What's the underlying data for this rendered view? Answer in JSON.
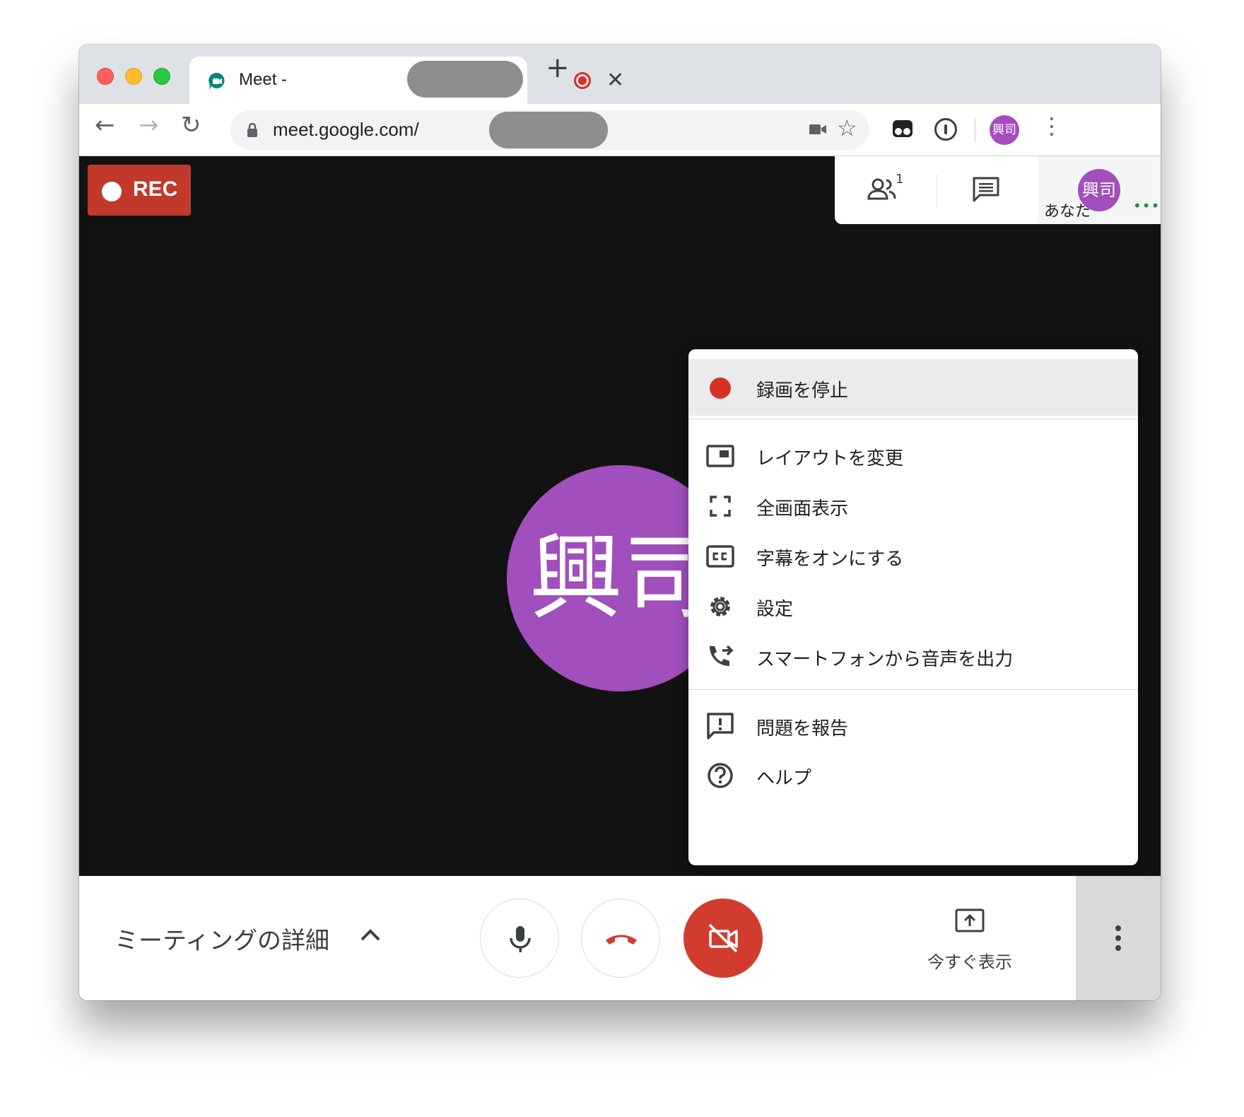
{
  "browser": {
    "tab": {
      "title": "Meet -",
      "close_glyph": "✕"
    },
    "new_tab_glyph": "+",
    "url": "meet.google.com/",
    "profile_initials": "興司",
    "nav": {
      "back": "←",
      "forward": "→",
      "reload": "↻",
      "star": "☆",
      "menu": "⋮"
    }
  },
  "meeting": {
    "rec_label": "REC",
    "participant_initials": "興司",
    "people_count": "1",
    "self_initials": "興司",
    "self_label": "あなた",
    "self_dots": "•••"
  },
  "menu": {
    "items": [
      {
        "label": "録画を停止",
        "icon": "record-dot-icon"
      },
      {
        "label": "レイアウトを変更",
        "icon": "layout-icon"
      },
      {
        "label": "全画面表示",
        "icon": "fullscreen-icon"
      },
      {
        "label": "字幕をオンにする",
        "icon": "closed-caption-icon"
      },
      {
        "label": "設定",
        "icon": "gear-icon"
      },
      {
        "label": "スマートフォンから音声を出力",
        "icon": "phone-forward-icon"
      },
      {
        "label": "問題を報告",
        "icon": "feedback-icon"
      },
      {
        "label": "ヘルプ",
        "icon": "help-icon"
      }
    ]
  },
  "bottombar": {
    "details_label": "ミーティングの詳細",
    "present_label": "今すぐ表示"
  },
  "colors": {
    "rec_red": "#c0392b",
    "avatar_purple": "#a04fbc",
    "hangup_red": "#d23c2f",
    "stage_black": "#121212"
  }
}
